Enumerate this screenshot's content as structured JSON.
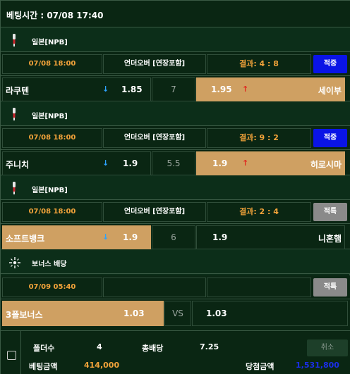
{
  "header": {
    "title": "베팅시간 : 07/08 17:40"
  },
  "games": [
    {
      "league": "일본[NPB]",
      "time": "07/08 18:00",
      "bet_type": "언더오버 [연장포함]",
      "result": "결과: 4 : 8",
      "status": "적중",
      "status_color": "#0a14e6",
      "home_team": "라쿠텐",
      "home_odds": "1.85",
      "home_arrow": "down",
      "line": "7",
      "away_odds": "1.95",
      "away_arrow": "up",
      "away_team": "세이부",
      "selected": "away"
    },
    {
      "league": "일본[NPB]",
      "time": "07/08 18:00",
      "bet_type": "언더오버 [연장포함]",
      "result": "결과: 9 : 2",
      "status": "적중",
      "status_color": "#0a14e6",
      "home_team": "주니치",
      "home_odds": "1.9",
      "home_arrow": "down",
      "line": "5.5",
      "away_odds": "1.9",
      "away_arrow": "up",
      "away_team": "히로시마",
      "selected": "away"
    },
    {
      "league": "일본[NPB]",
      "time": "07/08 18:00",
      "bet_type": "언더오버 [연장포함]",
      "result": "결과: 2 : 4",
      "status": "적특",
      "status_color": "#8a8a8a",
      "home_team": "소프트뱅크",
      "home_odds": "1.9",
      "home_arrow": "down",
      "line": "6",
      "away_odds": "1.9",
      "away_arrow": "",
      "away_team": "니혼햄",
      "selected": "home"
    }
  ],
  "bonus": {
    "league": "보너스 배당",
    "time": "07/09 05:40",
    "status": "적특",
    "status_color": "#8a8a8a",
    "home_team": "3폴보너스",
    "home_odds": "1.03",
    "line": "VS",
    "away_odds": "1.03",
    "selected": "home"
  },
  "footer": {
    "folders_label": "폴더수",
    "folders_value": "4",
    "total_odds_label": "총배당",
    "total_odds_value": "7.25",
    "cancel_label": "취소",
    "bet_amount_label": "베팅금액",
    "bet_amount_value": "414,000",
    "win_amount_label": "당첨금액",
    "win_amount_value": "1,531,800",
    "bet_amount_color": "#f2a33a",
    "win_amount_color": "#1a2ee8"
  }
}
